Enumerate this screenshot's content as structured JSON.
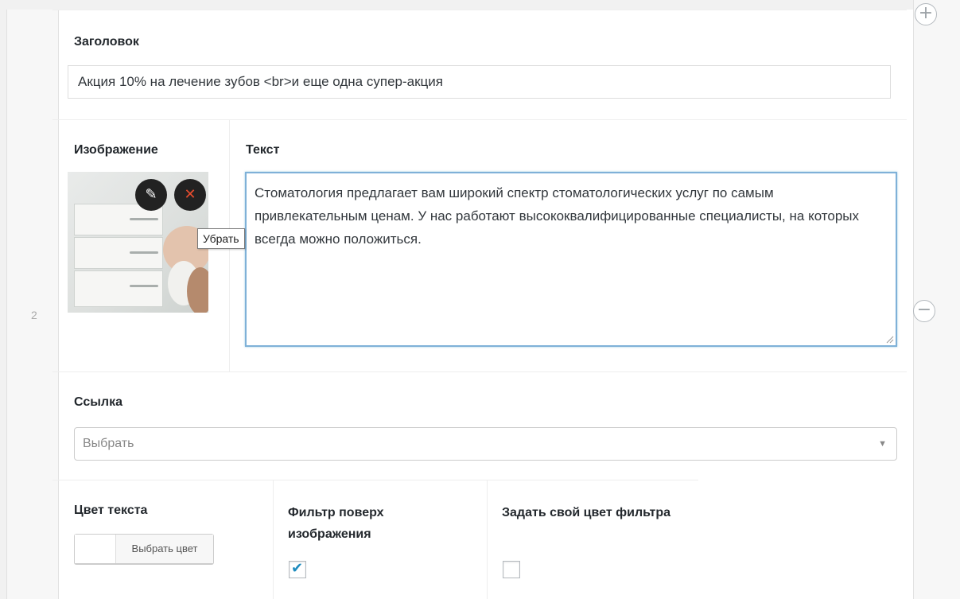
{
  "row": {
    "number": "2",
    "add_icon": "+",
    "remove_icon": "−"
  },
  "title_field": {
    "label": "Заголовок",
    "value": "Акция 10% на лечение зубов <br>и еще одна супер-акция"
  },
  "image_field": {
    "label": "Изображение",
    "edit_icon": "pencil-icon",
    "remove_icon": "close-icon",
    "edit_glyph": "✎",
    "remove_glyph": "✕",
    "tooltip": "Убрать"
  },
  "text_field": {
    "label": "Текст",
    "value": "Стоматология предлагает вам широкий спектр стоматологических услуг по самым привлекательным ценам. У нас работают высококвалифицированные специалисты, на которых всегда можно положиться."
  },
  "link_field": {
    "label": "Ссылка",
    "placeholder": "Выбрать",
    "arrow": "▼"
  },
  "text_color_field": {
    "label": "Цвет текста",
    "button_label": "Выбрать цвет",
    "value": "#ffffff"
  },
  "overlay_filter_field": {
    "label": "Фильтр поверх изображения",
    "checked": true,
    "checkmark": "✔"
  },
  "custom_filter_color_field": {
    "label": "Задать свой цвет фильтра",
    "checked": false
  },
  "colors": {
    "focus_border": "#7fb1d8",
    "remove_x": "#e54c2e",
    "checkmark": "#1e8cbe"
  }
}
